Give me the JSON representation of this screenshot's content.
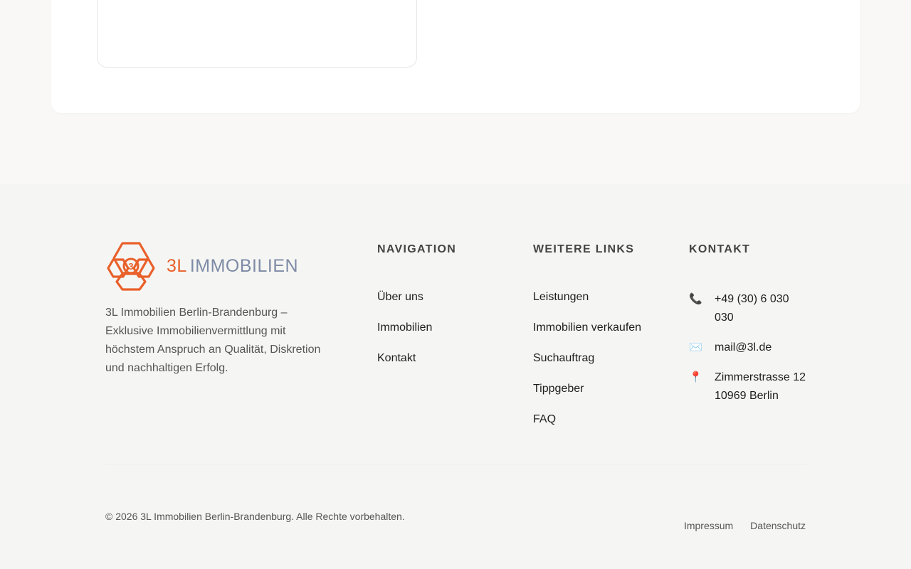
{
  "brand": {
    "logo_prefix": "3L",
    "logo_suffix": "IMMOBILIEN",
    "description": "3L Immobilien Berlin-Brandenburg – Exklusive Immobilienvermittlung mit höchstem Anspruch an Qualität, Diskretion und nachhaltigen Erfolg.",
    "colors": {
      "accent": "#e9602a",
      "secondary": "#7e8ba6"
    }
  },
  "navigation": {
    "heading": "NAVIGATION",
    "items": [
      {
        "label": "Über uns"
      },
      {
        "label": "Immobilien"
      },
      {
        "label": "Kontakt"
      }
    ]
  },
  "links": {
    "heading": "WEITERE LINKS",
    "items": [
      {
        "label": "Leistungen"
      },
      {
        "label": "Immobilien verkaufen"
      },
      {
        "label": "Suchauftrag"
      },
      {
        "label": "Tippgeber"
      },
      {
        "label": "FAQ"
      }
    ]
  },
  "contact": {
    "heading": "KONTAKT",
    "phone": {
      "icon": "phone-icon",
      "text": "+49 (30) 6 030 030"
    },
    "email": {
      "icon": "mail-icon",
      "text": "mail@3l.de"
    },
    "address": {
      "icon": "location-pin-icon",
      "street": "Zimmerstrasse 12",
      "city": "10969 Berlin"
    }
  },
  "bottom": {
    "copyright": "© 2026 3L Immobilien Berlin-Brandenburg. Alle Rechte vorbehalten.",
    "impressum": "Impressum",
    "datenschutz": "Datenschutz"
  }
}
